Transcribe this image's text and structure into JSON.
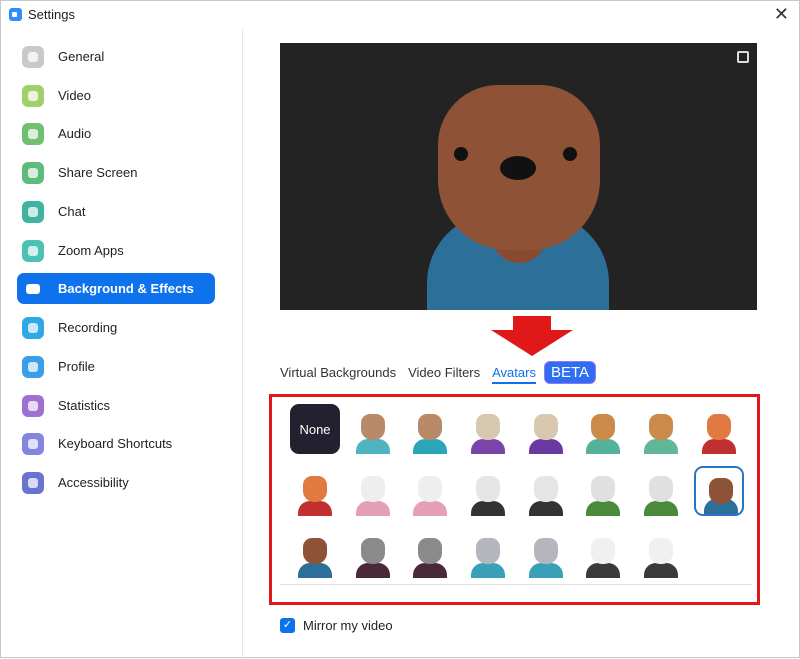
{
  "window": {
    "title": "Settings",
    "close_icon": "close-icon"
  },
  "sidebar": {
    "items": [
      {
        "label": "General",
        "icon": "gear-icon",
        "color": "#c9c9c9"
      },
      {
        "label": "Video",
        "icon": "video-camera-icon",
        "color": "#a3cf6b"
      },
      {
        "label": "Audio",
        "icon": "headphones-icon",
        "color": "#72bf72"
      },
      {
        "label": "Share Screen",
        "icon": "share-screen-icon",
        "color": "#5fbb7c"
      },
      {
        "label": "Chat",
        "icon": "chat-bubble-icon",
        "color": "#3fb3a0"
      },
      {
        "label": "Zoom Apps",
        "icon": "apps-icon",
        "color": "#4cc2b4"
      },
      {
        "label": "Background & Effects",
        "icon": "background-icon",
        "color": "#0e72ed",
        "active": true
      },
      {
        "label": "Recording",
        "icon": "record-icon",
        "color": "#30a8e8"
      },
      {
        "label": "Profile",
        "icon": "profile-icon",
        "color": "#3a9ee8"
      },
      {
        "label": "Statistics",
        "icon": "statistics-icon",
        "color": "#a070d0"
      },
      {
        "label": "Keyboard Shortcuts",
        "icon": "keyboard-icon",
        "color": "#8585e0"
      },
      {
        "label": "Accessibility",
        "icon": "accessibility-icon",
        "color": "#6a72d2"
      }
    ]
  },
  "tabs": [
    {
      "label": "Virtual Backgrounds"
    },
    {
      "label": "Video Filters"
    },
    {
      "label": "Avatars",
      "active": true
    }
  ],
  "beta_badge": "BETA",
  "avatars": {
    "none_label": "None",
    "items": [
      {
        "name": "cat",
        "head": "#b88a68",
        "shirt": "#4fb3c0"
      },
      {
        "name": "cat",
        "head": "#b88a68",
        "shirt": "#2aa6b8"
      },
      {
        "name": "cow",
        "head": "#d9c8b0",
        "shirt": "#7a45a8"
      },
      {
        "name": "cow",
        "head": "#d9c8b0",
        "shirt": "#6a3aa0"
      },
      {
        "name": "dog",
        "head": "#c98a4a",
        "shirt": "#54b29a"
      },
      {
        "name": "dog",
        "head": "#c98a4a",
        "shirt": "#60b896"
      },
      {
        "name": "fox",
        "head": "#e07a40",
        "shirt": "#c03030"
      },
      {
        "name": "fox",
        "head": "#e07a40",
        "shirt": "#c03030"
      },
      {
        "name": "bunny",
        "head": "#eeeeee",
        "shirt": "#e3a0b8"
      },
      {
        "name": "bunny",
        "head": "#eeeeee",
        "shirt": "#e3a0b8"
      },
      {
        "name": "polar-bear",
        "head": "#e5e5e5",
        "shirt": "#333333"
      },
      {
        "name": "polar-bear",
        "head": "#e5e5e5",
        "shirt": "#333333"
      },
      {
        "name": "panda",
        "head": "#e0e0e0",
        "shirt": "#4a8a3a"
      },
      {
        "name": "panda",
        "head": "#e0e0e0",
        "shirt": "#4a8a3a"
      },
      {
        "name": "brown-bear",
        "head": "#8e5236",
        "shirt": "#2c6f98",
        "selected": true
      },
      {
        "name": "brown-bear",
        "head": "#8e5236",
        "shirt": "#2c6f98"
      },
      {
        "name": "raccoon",
        "head": "#8a8a8a",
        "shirt": "#4a2a3a"
      },
      {
        "name": "raccoon",
        "head": "#8a8a8a",
        "shirt": "#4a2a3a"
      },
      {
        "name": "gray-cat",
        "head": "#b5b5bd",
        "shirt": "#3aa0b8"
      },
      {
        "name": "gray-cat",
        "head": "#b5b5bd",
        "shirt": "#3aa0b8"
      },
      {
        "name": "dairy-cow",
        "head": "#f0f0f0",
        "shirt": "#3a3a3a"
      },
      {
        "name": "dairy-cow",
        "head": "#f0f0f0",
        "shirt": "#3a3a3a"
      }
    ]
  },
  "mirror": {
    "label": "Mirror my video",
    "checked": true
  },
  "colors": {
    "accent": "#0e72ed",
    "annotation": "#e01818"
  }
}
